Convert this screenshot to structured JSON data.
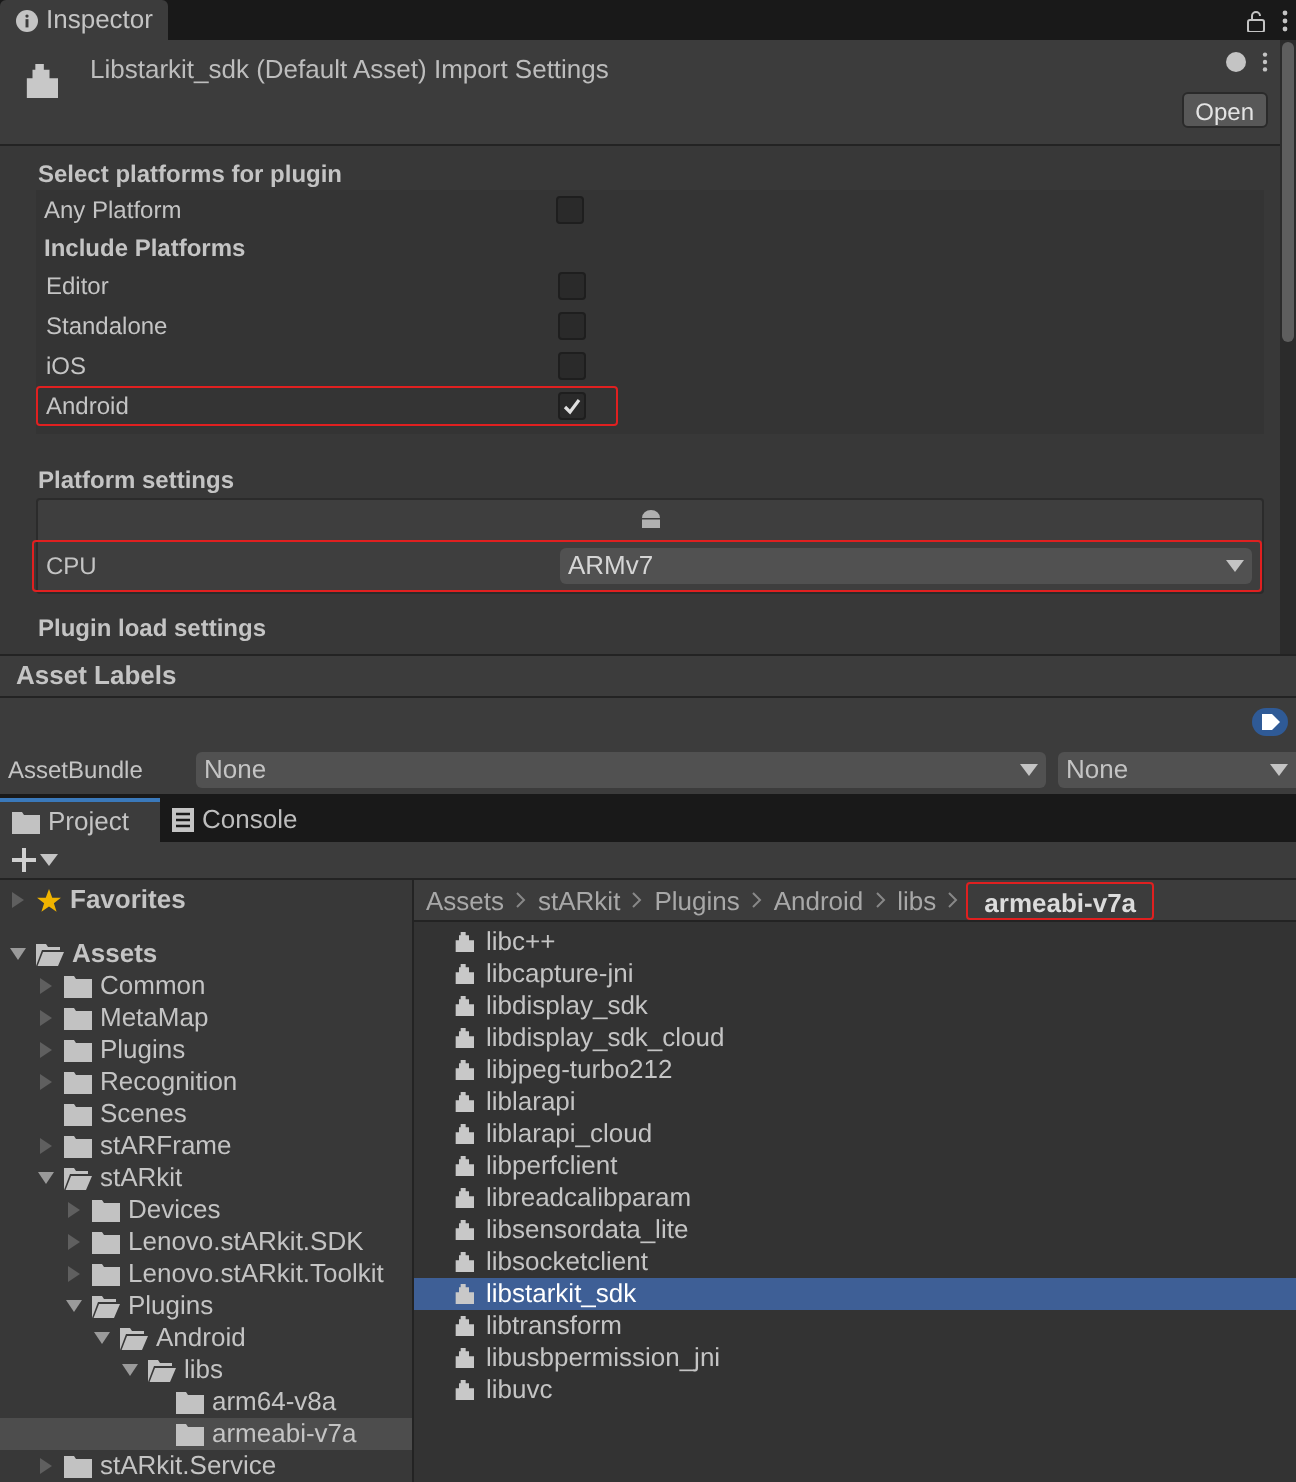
{
  "inspector_tab": {
    "label": "Inspector"
  },
  "header": {
    "title": "Libstarkit_sdk (Default Asset) Import Settings",
    "open_button": "Open"
  },
  "platforms_section": {
    "title": "Select platforms for plugin",
    "any_platform": {
      "label": "Any Platform",
      "checked": false
    },
    "include_title": "Include Platforms",
    "platforms": [
      {
        "label": "Editor",
        "checked": false,
        "highlighted": false
      },
      {
        "label": "Standalone",
        "checked": false,
        "highlighted": false
      },
      {
        "label": "iOS",
        "checked": false,
        "highlighted": false
      },
      {
        "label": "Android",
        "checked": true,
        "highlighted": true
      }
    ]
  },
  "platform_settings": {
    "title": "Platform settings",
    "cpu_label": "CPU",
    "cpu_value": "ARMv7",
    "highlighted": true
  },
  "plugin_load_title": "Plugin load settings",
  "asset_labels": {
    "title": "Asset Labels",
    "bundle_label": "AssetBundle",
    "bundle_value": "None",
    "variant_value": "None"
  },
  "project_tabs": [
    {
      "label": "Project",
      "selected": true,
      "kind": "folder"
    },
    {
      "label": "Console",
      "selected": false,
      "kind": "console"
    }
  ],
  "favorites": {
    "label": "Favorites",
    "expanded": false
  },
  "tree": [
    {
      "label": "Assets",
      "expandable": true,
      "expanded": true,
      "selected": false,
      "children": [
        {
          "label": "Common",
          "expandable": true,
          "expanded": false,
          "selected": false
        },
        {
          "label": "MetaMap",
          "expandable": true,
          "expanded": false,
          "selected": false
        },
        {
          "label": "Plugins",
          "expandable": true,
          "expanded": false,
          "selected": false
        },
        {
          "label": "Recognition",
          "expandable": true,
          "expanded": false,
          "selected": false
        },
        {
          "label": "Scenes",
          "expandable": false,
          "expanded": false,
          "selected": false
        },
        {
          "label": "stARFrame",
          "expandable": true,
          "expanded": false,
          "selected": false
        },
        {
          "label": "stARkit",
          "expandable": true,
          "expanded": true,
          "selected": false,
          "children": [
            {
              "label": "Devices",
              "expandable": true,
              "expanded": false,
              "selected": false
            },
            {
              "label": "Lenovo.stARkit.SDK",
              "expandable": true,
              "expanded": false,
              "selected": false
            },
            {
              "label": "Lenovo.stARkit.Toolkit",
              "expandable": true,
              "expanded": false,
              "selected": false
            },
            {
              "label": "Plugins",
              "expandable": true,
              "expanded": true,
              "selected": false,
              "children": [
                {
                  "label": "Android",
                  "expandable": true,
                  "expanded": true,
                  "selected": false,
                  "children": [
                    {
                      "label": "libs",
                      "expandable": true,
                      "expanded": true,
                      "selected": false,
                      "children": [
                        {
                          "label": "arm64-v8a",
                          "expandable": false,
                          "expanded": false,
                          "selected": false
                        },
                        {
                          "label": "armeabi-v7a",
                          "expandable": false,
                          "expanded": false,
                          "selected": true
                        }
                      ]
                    }
                  ]
                }
              ]
            }
          ]
        },
        {
          "label": "stARkit.Service",
          "expandable": true,
          "expanded": false,
          "selected": false
        }
      ]
    }
  ],
  "breadcrumb": [
    {
      "label": "Assets",
      "highlighted": false
    },
    {
      "label": "stARkit",
      "highlighted": false
    },
    {
      "label": "Plugins",
      "highlighted": false
    },
    {
      "label": "Android",
      "highlighted": false
    },
    {
      "label": "libs",
      "highlighted": false
    },
    {
      "label": "armeabi-v7a",
      "highlighted": true
    }
  ],
  "files": [
    {
      "label": "libc++",
      "selected": false
    },
    {
      "label": "libcapture-jni",
      "selected": false
    },
    {
      "label": "libdisplay_sdk",
      "selected": false
    },
    {
      "label": "libdisplay_sdk_cloud",
      "selected": false
    },
    {
      "label": "libjpeg-turbo212",
      "selected": false
    },
    {
      "label": "liblarapi",
      "selected": false
    },
    {
      "label": "liblarapi_cloud",
      "selected": false
    },
    {
      "label": "libperfclient",
      "selected": false
    },
    {
      "label": "libreadcalibparam",
      "selected": false
    },
    {
      "label": "libsensordata_lite",
      "selected": false
    },
    {
      "label": "libsocketclient",
      "selected": false
    },
    {
      "label": "libstarkit_sdk",
      "selected": true
    },
    {
      "label": "libtransform",
      "selected": false
    },
    {
      "label": "libusbpermission_jni",
      "selected": false
    },
    {
      "label": "libuvc",
      "selected": false
    }
  ]
}
